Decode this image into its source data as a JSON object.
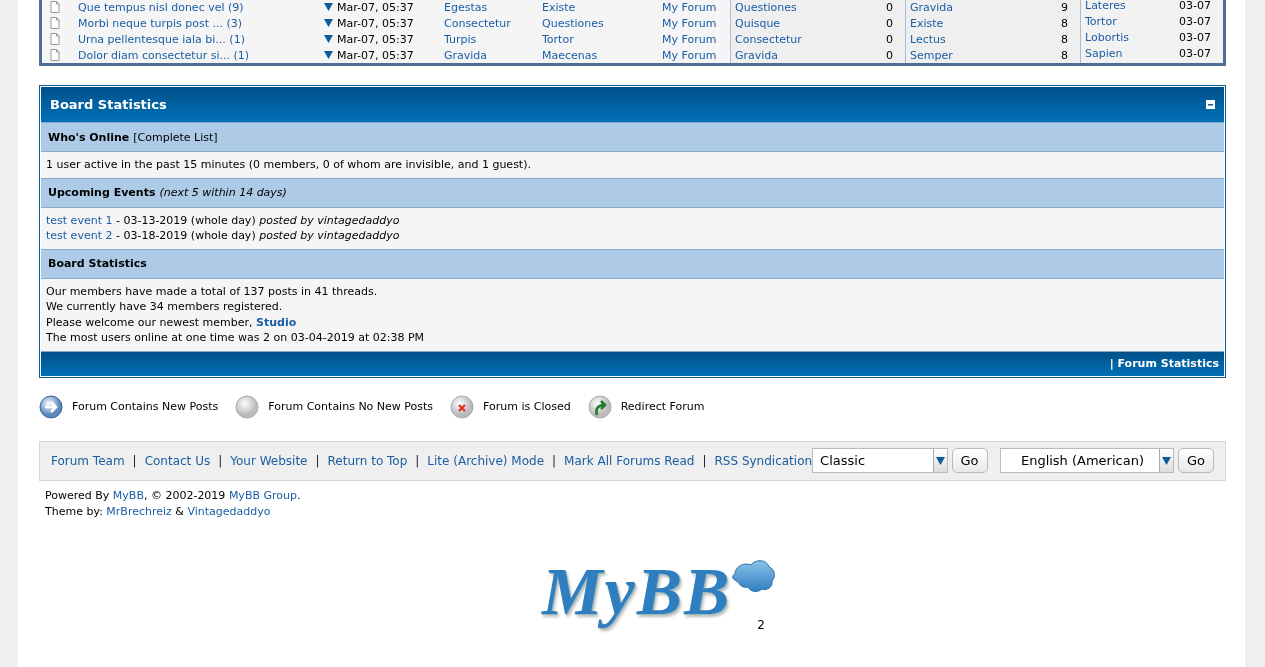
{
  "recent_threads": {
    "rows": [
      {
        "title": "Que tempus nisl donec vel (9)",
        "date": "Mar-07, 05:37",
        "column_3": "Egestas",
        "column_4": "Existe",
        "forum": "My Forum"
      },
      {
        "title": "Morbi neque turpis post ... (3)",
        "date": "Mar-07, 05:37",
        "column_3": "Consectetur",
        "column_4": "Questiones",
        "forum": "My Forum"
      },
      {
        "title": "Urna pellentesque iala bi... (1)",
        "date": "Mar-07, 05:37",
        "column_3": "Turpis",
        "column_4": "Tortor",
        "forum": "My Forum"
      },
      {
        "title": "Dolor diam consectetur si... (1)",
        "date": "Mar-07, 05:37",
        "column_3": "Gravida",
        "column_4": "Maecenas",
        "forum": "My Forum"
      }
    ]
  },
  "side_lists": [
    {
      "items": [
        {
          "name": "Questiones",
          "value": "0"
        },
        {
          "name": "Quisque",
          "value": "0"
        },
        {
          "name": "Consectetur",
          "value": "0"
        },
        {
          "name": "Gravida",
          "value": "0"
        }
      ]
    },
    {
      "items": [
        {
          "name": "Gravida",
          "value": "9"
        },
        {
          "name": "Existe",
          "value": "8"
        },
        {
          "name": "Lectus",
          "value": "8"
        },
        {
          "name": "Semper",
          "value": "8"
        }
      ]
    },
    {
      "items": [
        {
          "name": "Lateres",
          "value": "03-07"
        },
        {
          "name": "Tortor",
          "value": "03-07"
        },
        {
          "name": "Lobortis",
          "value": "03-07"
        },
        {
          "name": "Sapien",
          "value": "03-07"
        }
      ]
    }
  ],
  "board_statistics": {
    "title": "Board Statistics",
    "sections": [
      {
        "heading": "Who's Online",
        "heading_link": "[Complete List]",
        "lines": [
          [
            {
              "kind": "text",
              "text": "1 user active in the past 15 minutes (0 members, 0 of whom are invisible, and 1 guest)."
            }
          ]
        ]
      },
      {
        "heading": "Upcoming Events",
        "note": "(next 5 within 14 days)",
        "lines": [
          [
            {
              "kind": "link",
              "text": "test event 1"
            },
            {
              "kind": "text",
              "text": " - 03-13-2019 (whole day) *posted by vintagedaddyo*"
            }
          ],
          [
            {
              "kind": "link",
              "text": "test event 2"
            },
            {
              "kind": "text",
              "text": " - 03-18-2019 (whole day) *posted by vintagedaddyo*"
            }
          ]
        ]
      },
      {
        "heading": "Board Statistics",
        "lines": [
          [
            {
              "kind": "text",
              "text": "Our members have made a total of 137 posts in 41 threads."
            }
          ],
          [
            {
              "kind": "text",
              "text": "We currently have 34 members registered."
            }
          ],
          [
            {
              "kind": "text",
              "text": "Please welcome our newest member, "
            },
            {
              "kind": "bold_link",
              "text": "Studio"
            }
          ],
          [
            {
              "kind": "text",
              "text": "The most users online at one time was 2 on 03-04-2019 at 02:38 PM"
            }
          ]
        ]
      }
    ],
    "footer_link": "| Forum Statistics"
  },
  "legend": [
    {
      "kind": "new",
      "label": "Forum Contains New Posts"
    },
    {
      "kind": "no_new",
      "label": "Forum Contains No New Posts"
    },
    {
      "kind": "closed",
      "label": "Forum is Closed"
    },
    {
      "kind": "redirect",
      "label": "Redirect Forum"
    }
  ],
  "footer": {
    "links": [
      {
        "label": "Forum Team"
      },
      {
        "label": "Contact Us",
        "separator": "|"
      },
      {
        "label": "Your Website",
        "separator": "|"
      },
      {
        "label": "Return to Top",
        "separator": "|"
      },
      {
        "label": "Lite (Archive) Mode",
        "separator": "|"
      },
      {
        "label": "Mark All Forums Read",
        "separator": "|"
      },
      {
        "label": "RSS Syndication",
        "separator": "|"
      }
    ],
    "theme_select": {
      "value": "Classic",
      "button": "Go"
    },
    "language_select": {
      "value": "English (American)",
      "button": "Go"
    }
  },
  "copyright": [
    [
      {
        "kind": "text",
        "text": "Powered By "
      },
      {
        "kind": "link",
        "text": "MyBB"
      },
      {
        "kind": "text",
        "text": ", © 2002-2019 "
      },
      {
        "kind": "link",
        "text": "MyBB Group"
      },
      {
        "kind": "text",
        "text": "."
      }
    ],
    [
      {
        "kind": "text",
        "text": "Theme by: "
      },
      {
        "kind": "link",
        "text": "MrBrechreiz"
      },
      {
        "kind": "text",
        "text": " & "
      },
      {
        "kind": "link",
        "text": "Vintagedaddyo"
      }
    ]
  ],
  "logo": {
    "text": "MyBB"
  },
  "page_number": "2"
}
